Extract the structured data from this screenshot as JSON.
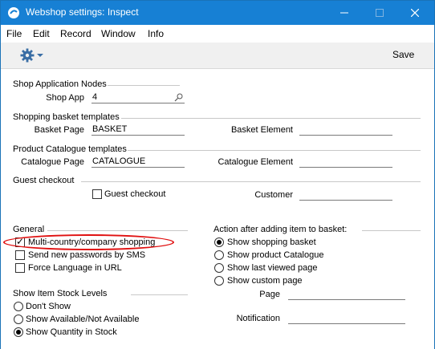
{
  "window": {
    "title": "Webshop settings: Inspect",
    "accent_color": "#1780d4",
    "highlight_color": "#e01010"
  },
  "menu": [
    "File",
    "Edit",
    "Record",
    "Window",
    "Info"
  ],
  "toolbar": {
    "actions_icon": "gear-icon",
    "save_label": "Save"
  },
  "sections": {
    "shop_nodes": {
      "heading": "Shop Application Nodes",
      "shop_app_label": "Shop App",
      "shop_app_value": "4"
    },
    "basket": {
      "heading": "Shopping basket templates",
      "page_label": "Basket Page",
      "page_value": "BASKET",
      "element_label": "Basket Element",
      "element_value": ""
    },
    "catalogue": {
      "heading": "Product Catalogue templates",
      "page_label": "Catalogue Page",
      "page_value": "CATALOGUE",
      "element_label": "Catalogue Element",
      "element_value": ""
    },
    "guest": {
      "heading": "Guest checkout",
      "checkbox_label": "Guest checkout",
      "checked": false,
      "customer_label": "Customer",
      "customer_value": ""
    },
    "general": {
      "heading": "General",
      "options": [
        {
          "label": "Multi-country/company shopping",
          "checked": true
        },
        {
          "label": "Send new passwords by SMS",
          "checked": false
        },
        {
          "label": "Force Language in URL",
          "checked": false
        }
      ]
    },
    "after_add": {
      "heading": "Action after adding item to basket:",
      "options": [
        {
          "label": "Show shopping basket",
          "selected": true
        },
        {
          "label": "Show product Catalogue",
          "selected": false
        },
        {
          "label": "Show last viewed page",
          "selected": false
        },
        {
          "label": "Show custom page",
          "selected": false
        }
      ],
      "page_label": "Page",
      "page_value": "",
      "notification_label": "Notification",
      "notification_value": ""
    },
    "stock": {
      "heading": "Show Item Stock Levels",
      "options": [
        {
          "label": "Don't Show",
          "selected": false
        },
        {
          "label": "Show Available/Not Available",
          "selected": false
        },
        {
          "label": "Show Quantity in Stock",
          "selected": true
        }
      ]
    }
  }
}
